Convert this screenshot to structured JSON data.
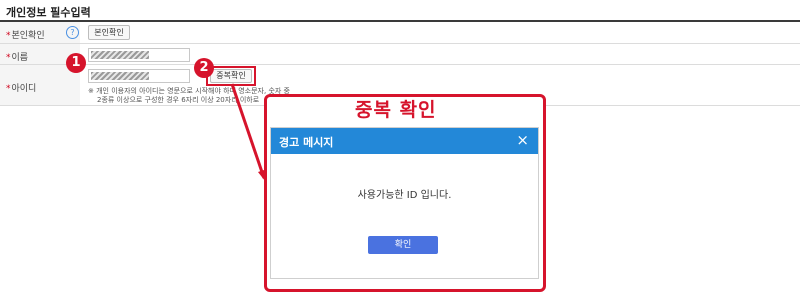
{
  "section": {
    "title": "개인정보 필수입력"
  },
  "rows": {
    "identity": {
      "required_mark": "*",
      "label": "본인확인",
      "help_icon": "?",
      "button_label": "본인확인"
    },
    "name": {
      "required_mark": "*",
      "label": "이름"
    },
    "userid": {
      "required_mark": "*",
      "label": "아이디",
      "dup_check_label": "중복확인",
      "note_line1": "※ 개인 이용자의 아이디는 영문으로 시작해야 하며 영소문자, 숫자 중",
      "note_line2": "2종류 이상으로 구성한 경우 6자리 이상 20자리 이하로"
    }
  },
  "annotations": {
    "badge1": "1",
    "badge2": "2",
    "callout_title": "중복 확인",
    "accent_color": "#d6142c"
  },
  "dialog": {
    "title": "경고 메시지",
    "close_icon": "×",
    "message": "사용가능한 ID 입니다.",
    "ok_label": "확인",
    "header_color": "#2388d8"
  }
}
